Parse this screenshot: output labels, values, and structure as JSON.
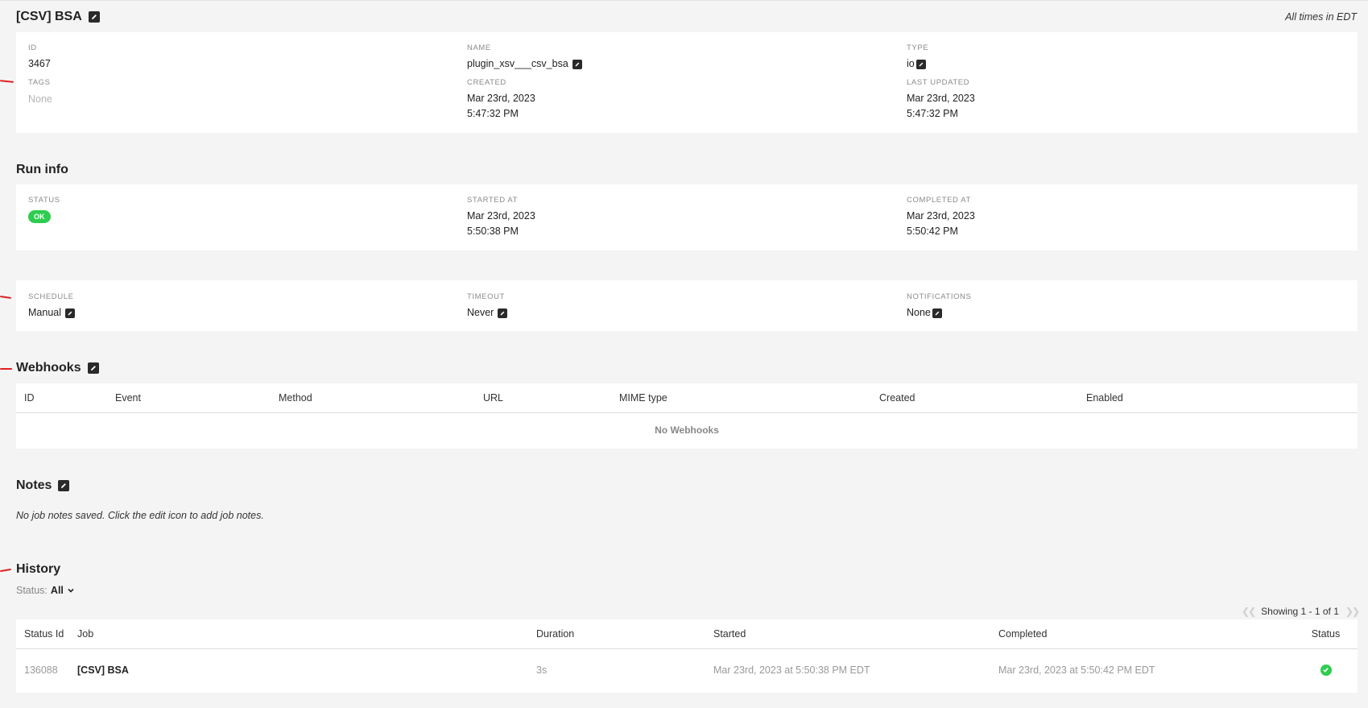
{
  "job": {
    "title": "[CSV] BSA",
    "timezone_note": "All times in EDT",
    "id_label": "ID",
    "id_value": "3467",
    "name_label": "NAME",
    "name_value": "plugin_xsv___csv_bsa",
    "type_label": "TYPE",
    "type_value": "io",
    "tags_label": "TAGS",
    "tags_value": "None",
    "created_label": "CREATED",
    "created_date": "Mar 23rd, 2023",
    "created_time": "5:47:32 PM",
    "updated_label": "LAST UPDATED",
    "updated_date": "Mar 23rd, 2023",
    "updated_time": "5:47:32 PM"
  },
  "run_info": {
    "title": "Run info",
    "status_label": "STATUS",
    "status_value": "OK",
    "started_label": "STARTED AT",
    "started_date": "Mar 23rd, 2023",
    "started_time": "5:50:38 PM",
    "completed_label": "COMPLETED AT",
    "completed_date": "Mar 23rd, 2023",
    "completed_time": "5:50:42 PM"
  },
  "settings": {
    "schedule_label": "SCHEDULE",
    "schedule_value": "Manual",
    "timeout_label": "TIMEOUT",
    "timeout_value": "Never",
    "notifications_label": "NOTIFICATIONS",
    "notifications_value": "None"
  },
  "webhooks": {
    "title": "Webhooks",
    "columns": [
      "ID",
      "Event",
      "Method",
      "URL",
      "MIME type",
      "Created",
      "Enabled"
    ],
    "empty_message": "No Webhooks"
  },
  "notes": {
    "title": "Notes",
    "message": "No job notes saved. Click the edit icon to add job notes."
  },
  "history": {
    "title": "History",
    "filter_label": "Status:",
    "filter_value": "All",
    "pager_text": "Showing 1 - 1 of 1",
    "columns": [
      "Status Id",
      "Job",
      "Duration",
      "Started",
      "Completed",
      "Status"
    ],
    "rows": [
      {
        "status_id": "136088",
        "job": "[CSV] BSA",
        "duration": "3s",
        "started": "Mar 23rd, 2023 at 5:50:38 PM EDT",
        "completed": "Mar 23rd, 2023 at 5:50:42 PM EDT",
        "status_icon": "check-circle-icon"
      }
    ]
  },
  "colors": {
    "background": "#f4f4f4",
    "ok_green": "#2ecc4f",
    "annotation_red": "#e02020"
  }
}
